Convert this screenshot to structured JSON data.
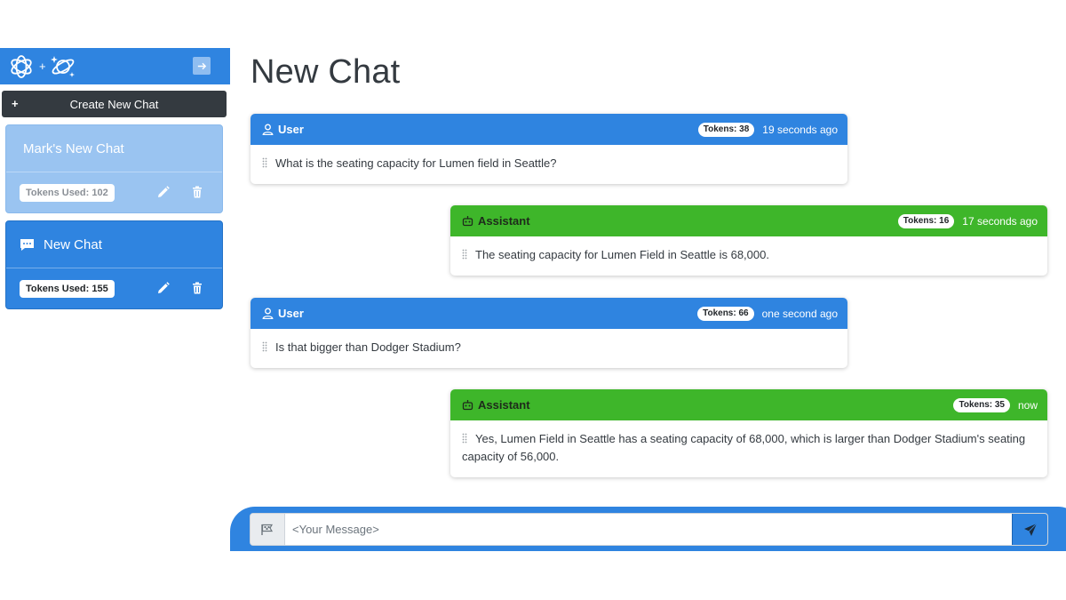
{
  "sidebar": {
    "logo_separator": "+",
    "create_button": {
      "icon": "+",
      "label": "Create New Chat"
    },
    "chats": [
      {
        "title": "Mark's New Chat",
        "tokens_label": "Tokens Used: 102",
        "selected": false
      },
      {
        "title": "New Chat",
        "tokens_label": "Tokens Used: 155",
        "selected": true
      }
    ]
  },
  "main": {
    "title": "New Chat",
    "messages": [
      {
        "role": "User",
        "tokens": "Tokens: 38",
        "time": "19 seconds ago",
        "text": "What is the seating capacity for Lumen field in Seattle?"
      },
      {
        "role": "Assistant",
        "tokens": "Tokens: 16",
        "time": "17 seconds ago",
        "text": "The seating capacity for Lumen Field in Seattle is 68,000."
      },
      {
        "role": "User",
        "tokens": "Tokens: 66",
        "time": "one second ago",
        "text": "Is that bigger than Dodger Stadium?"
      },
      {
        "role": "Assistant",
        "tokens": "Tokens: 35",
        "time": "now",
        "text": "Yes, Lumen Field in Seattle has a seating capacity of 68,000, which is larger than Dodger Stadium's seating capacity of 56,000."
      }
    ]
  },
  "composer": {
    "placeholder": "<Your Message>",
    "value": ""
  },
  "icons": {
    "openai_logo": "openai-logo-icon",
    "planet_logo": "planet-sparkle-icon",
    "collapse": "arrow-right-icon",
    "chat": "chat-bubble-icon",
    "edit": "pencil-icon",
    "delete": "trash-icon",
    "user": "person-icon",
    "assistant": "robot-icon",
    "drag": "grip-icon",
    "attach": "flag-icon",
    "send": "send-icon"
  },
  "colors": {
    "primary": "#2f84e0",
    "primary_light": "#9ac4f1",
    "success": "#3eb62a",
    "dark": "#343a40"
  }
}
